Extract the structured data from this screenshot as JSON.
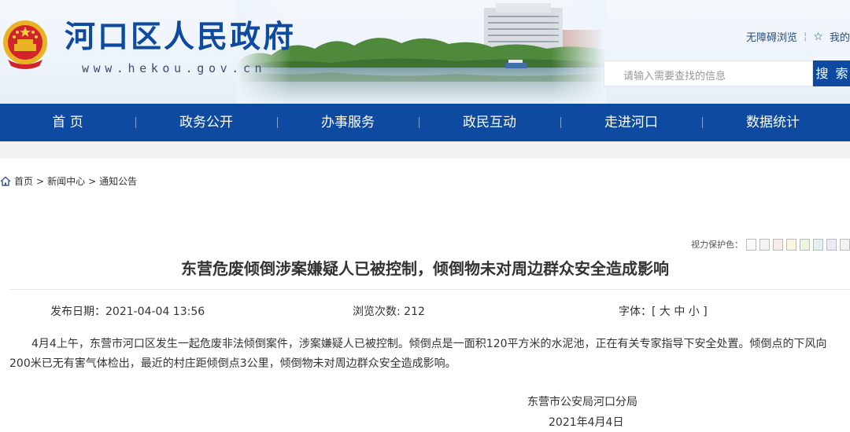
{
  "header": {
    "site_title": "河口区人民政府",
    "site_domain": "www.hekou.gov.cn",
    "accessibility_link": "无障碍浏览",
    "favorite_link": "我的",
    "search_placeholder": "请输入需要查找的信息",
    "search_button": "搜 索",
    "brand_color": "#0d4aa0"
  },
  "nav": {
    "items": [
      "首 页",
      "政务公开",
      "办事服务",
      "政民互动",
      "走进河口",
      "数据统计"
    ]
  },
  "breadcrumb": {
    "items": [
      "首页",
      "新闻中心",
      "通知公告"
    ],
    "separator": ">"
  },
  "article": {
    "eye_care_label": "视力保护色：",
    "eye_care_colors": [
      "#fafafa",
      "#f4f4f4",
      "#fbe9e9",
      "#fdf4e1",
      "#eef6dc",
      "#e2f1ef",
      "#e9eef6",
      "#f2f2f2"
    ],
    "title": "东营危废倾倒涉案嫌疑人已被控制，倾倒物未对周边群众安全造成影响",
    "publish_date": "发布日期：2021-04-04 13:56",
    "views": "浏览次数: 212",
    "font_size_label": "字体：[ 大 中 小 ]",
    "body": "4月4上午，东营市河口区发生一起危废非法倾倒案件，涉案嫌疑人已被控制。倾倒点是一面积120平方米的水泥池，正在有关专家指导下安全处置。倾倒点的下风向200米已无有害气体检出，最近的村庄距倾倒点3公里，倾倒物未对周边群众安全造成影响。",
    "signature_org": "东营市公安局河口分局",
    "signature_date": "2021年4月4日"
  }
}
